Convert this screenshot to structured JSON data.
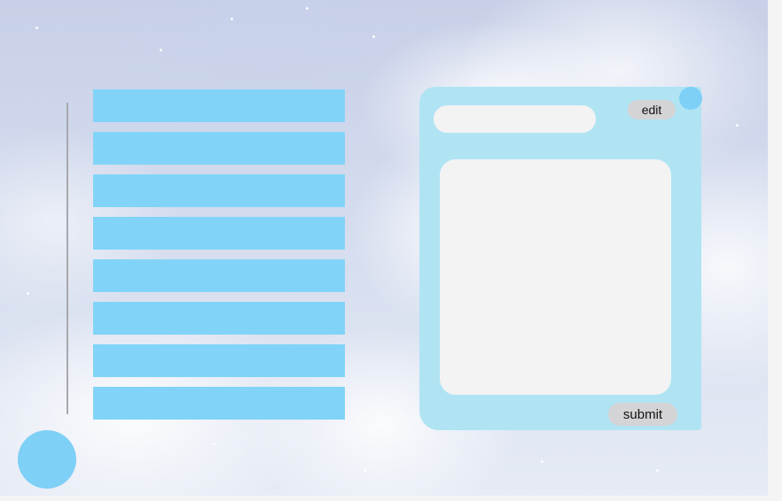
{
  "list": {
    "items": [
      {
        "label": ""
      },
      {
        "label": ""
      },
      {
        "label": ""
      },
      {
        "label": ""
      },
      {
        "label": ""
      },
      {
        "label": ""
      },
      {
        "label": ""
      },
      {
        "label": ""
      }
    ]
  },
  "editor": {
    "title_value": "",
    "body_value": "",
    "edit_label": "edit",
    "submit_label": "submit"
  },
  "colors": {
    "list_item": "#81d4f8",
    "panel": "#b0e4f3",
    "accent_circle": "#7fd0f7",
    "field": "#f3f3f4",
    "button": "#d4d4d6"
  },
  "icons": {
    "fab": "circle-button-icon",
    "corner": "circle-dot-icon"
  }
}
